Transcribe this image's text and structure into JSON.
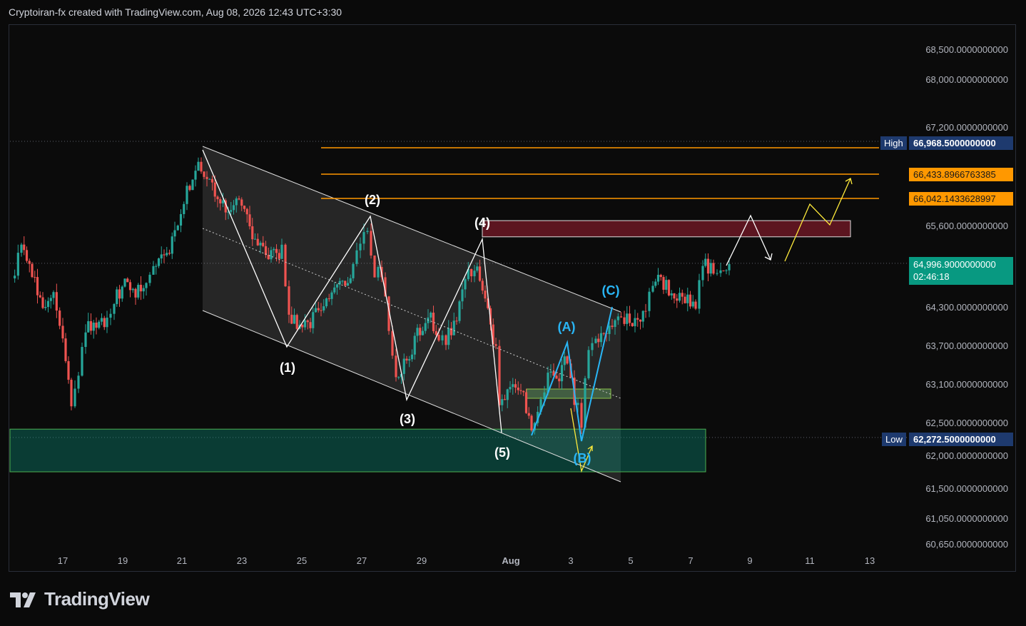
{
  "header": {
    "attribution": "Cryptoiran-fx created with TradingView.com, Aug 08, 2026 12:43 UTC+3:30"
  },
  "footer": {
    "logo_text": "TradingView"
  },
  "price_tags": {
    "high_label": "High",
    "high_value": "66,968.5000000000",
    "fib1_value": "66,433.8966763385",
    "fib2_value": "66,042.1433628997",
    "current_value": "64,996.9000000000",
    "countdown": "02:46:18",
    "low_label": "Low",
    "low_value": "62,272.5000000000"
  },
  "colors": {
    "up": "#26a69a",
    "down": "#ef5350",
    "orange_line": "#ff9800",
    "current_tag": "#089981",
    "hl_tag": "#1e3a6e",
    "wave_blue": "#29b6f6",
    "projection_yellow": "#ffeb3b"
  },
  "chart_data": {
    "type": "candlestick",
    "y_axis_ticks": [
      "68,500.0000000000",
      "68,000.0000000000",
      "67,200.0000000000",
      "65,600.0000000000",
      "64,300.0000000000",
      "63,700.0000000000",
      "63,100.0000000000",
      "62,500.0000000000",
      "62,000.0000000000",
      "61,500.0000000000",
      "61,050.0000000000",
      "60,650.0000000000"
    ],
    "x_axis_ticks": [
      "17",
      "19",
      "21",
      "23",
      "25",
      "27",
      "29",
      "Aug",
      "3",
      "5",
      "7",
      "9",
      "11",
      "13"
    ],
    "high": 66968.5,
    "low": 62272.5,
    "last_price": 64996.9,
    "horizontal_levels": [
      66968.5,
      66433.8966763385,
      66042.1433628997
    ],
    "wave_labels": [
      "(1)",
      "(2)",
      "(3)",
      "(4)",
      "(5)",
      "(A)",
      "(B)",
      "(C)"
    ],
    "zones": [
      {
        "name": "supply",
        "from": 65420,
        "to": 65680
      },
      {
        "name": "demand",
        "from": 61750,
        "to": 62400
      }
    ]
  }
}
